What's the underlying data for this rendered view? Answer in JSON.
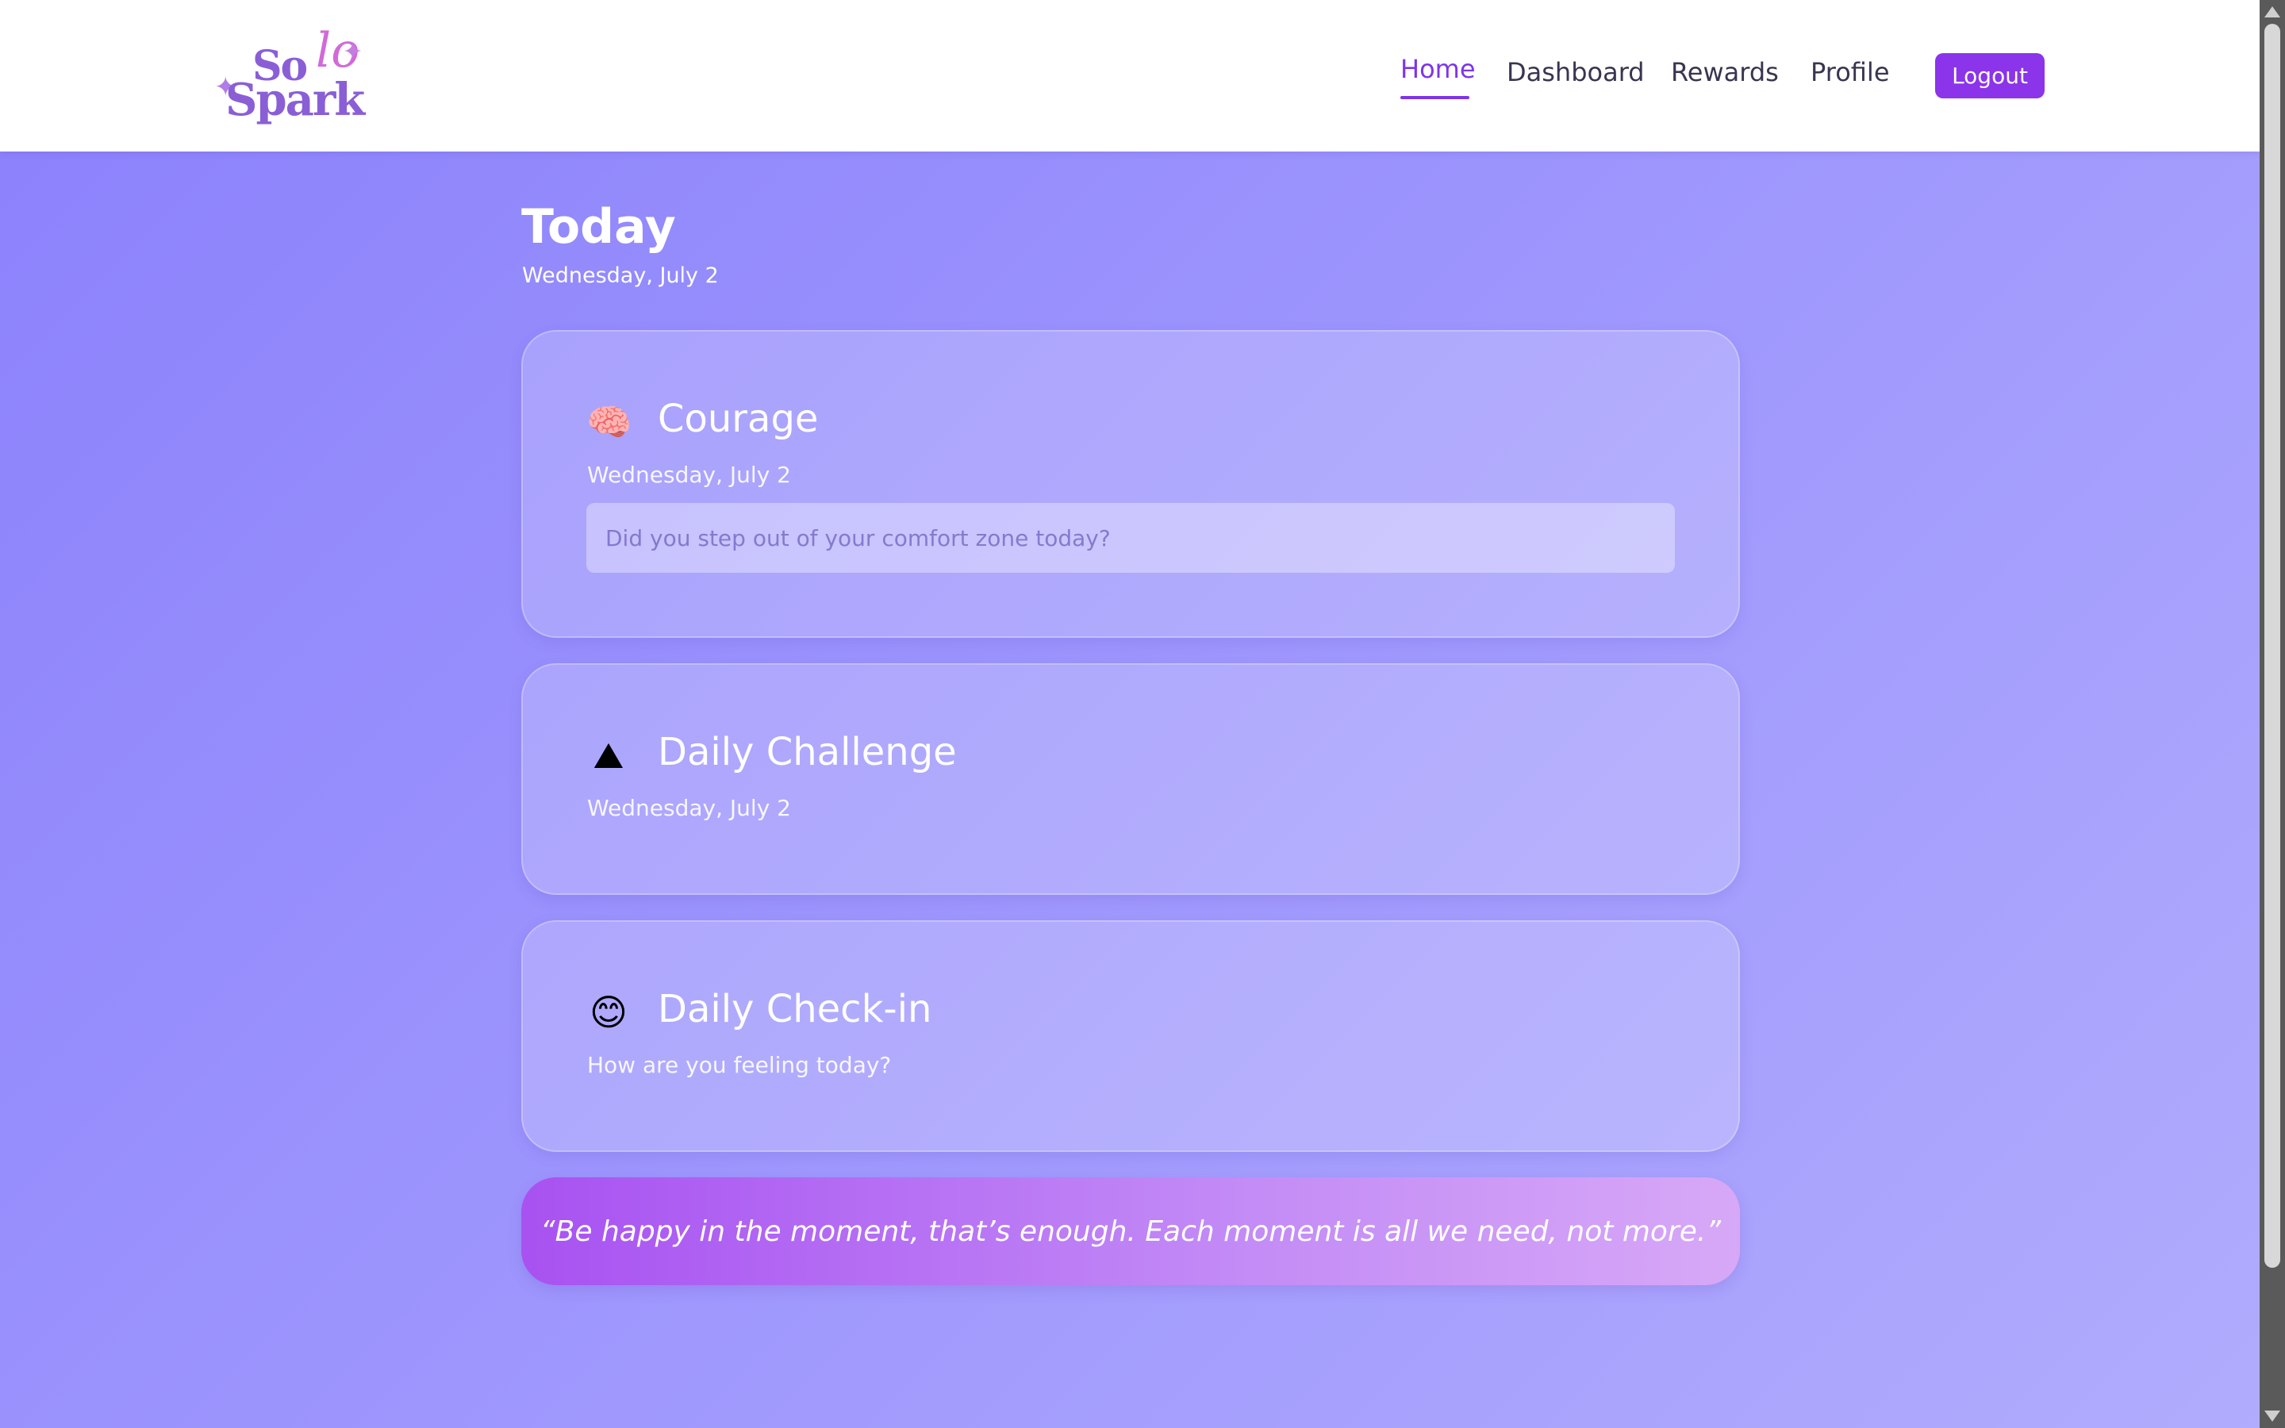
{
  "header": {
    "logo": {
      "text_solo": "Solo",
      "text_spark": "Spark"
    },
    "nav": [
      {
        "label": "Home"
      },
      {
        "label": "Dashboard"
      },
      {
        "label": "Rewards"
      },
      {
        "label": "Profile"
      }
    ],
    "active_nav": "Home",
    "logout_label": "Logout"
  },
  "page": {
    "title": "Today",
    "date": "Wednesday, July 2"
  },
  "cards": {
    "courage": {
      "icon": "brain-icon",
      "title": "Courage",
      "subtitle": "Wednesday, July 2",
      "input_value": "",
      "input_placeholder": "Did you step out of your comfort zone today?"
    },
    "challenge": {
      "icon": "mountain-icon",
      "title": "Daily Challenge",
      "subtitle": "Wednesday, July 2"
    },
    "checkin": {
      "icon": "smiling-face-icon",
      "title": "Daily Check-in",
      "subtitle": "How are you feeling today?"
    }
  },
  "quote": {
    "text": "“Be happy in the moment, that’s enough. Each moment is all we need, not more.”"
  },
  "colors": {
    "accent": "#8b34ea",
    "nav_active": "#7e35e8",
    "background_start": "#8b80fc",
    "background_end": "#b1acfd"
  }
}
